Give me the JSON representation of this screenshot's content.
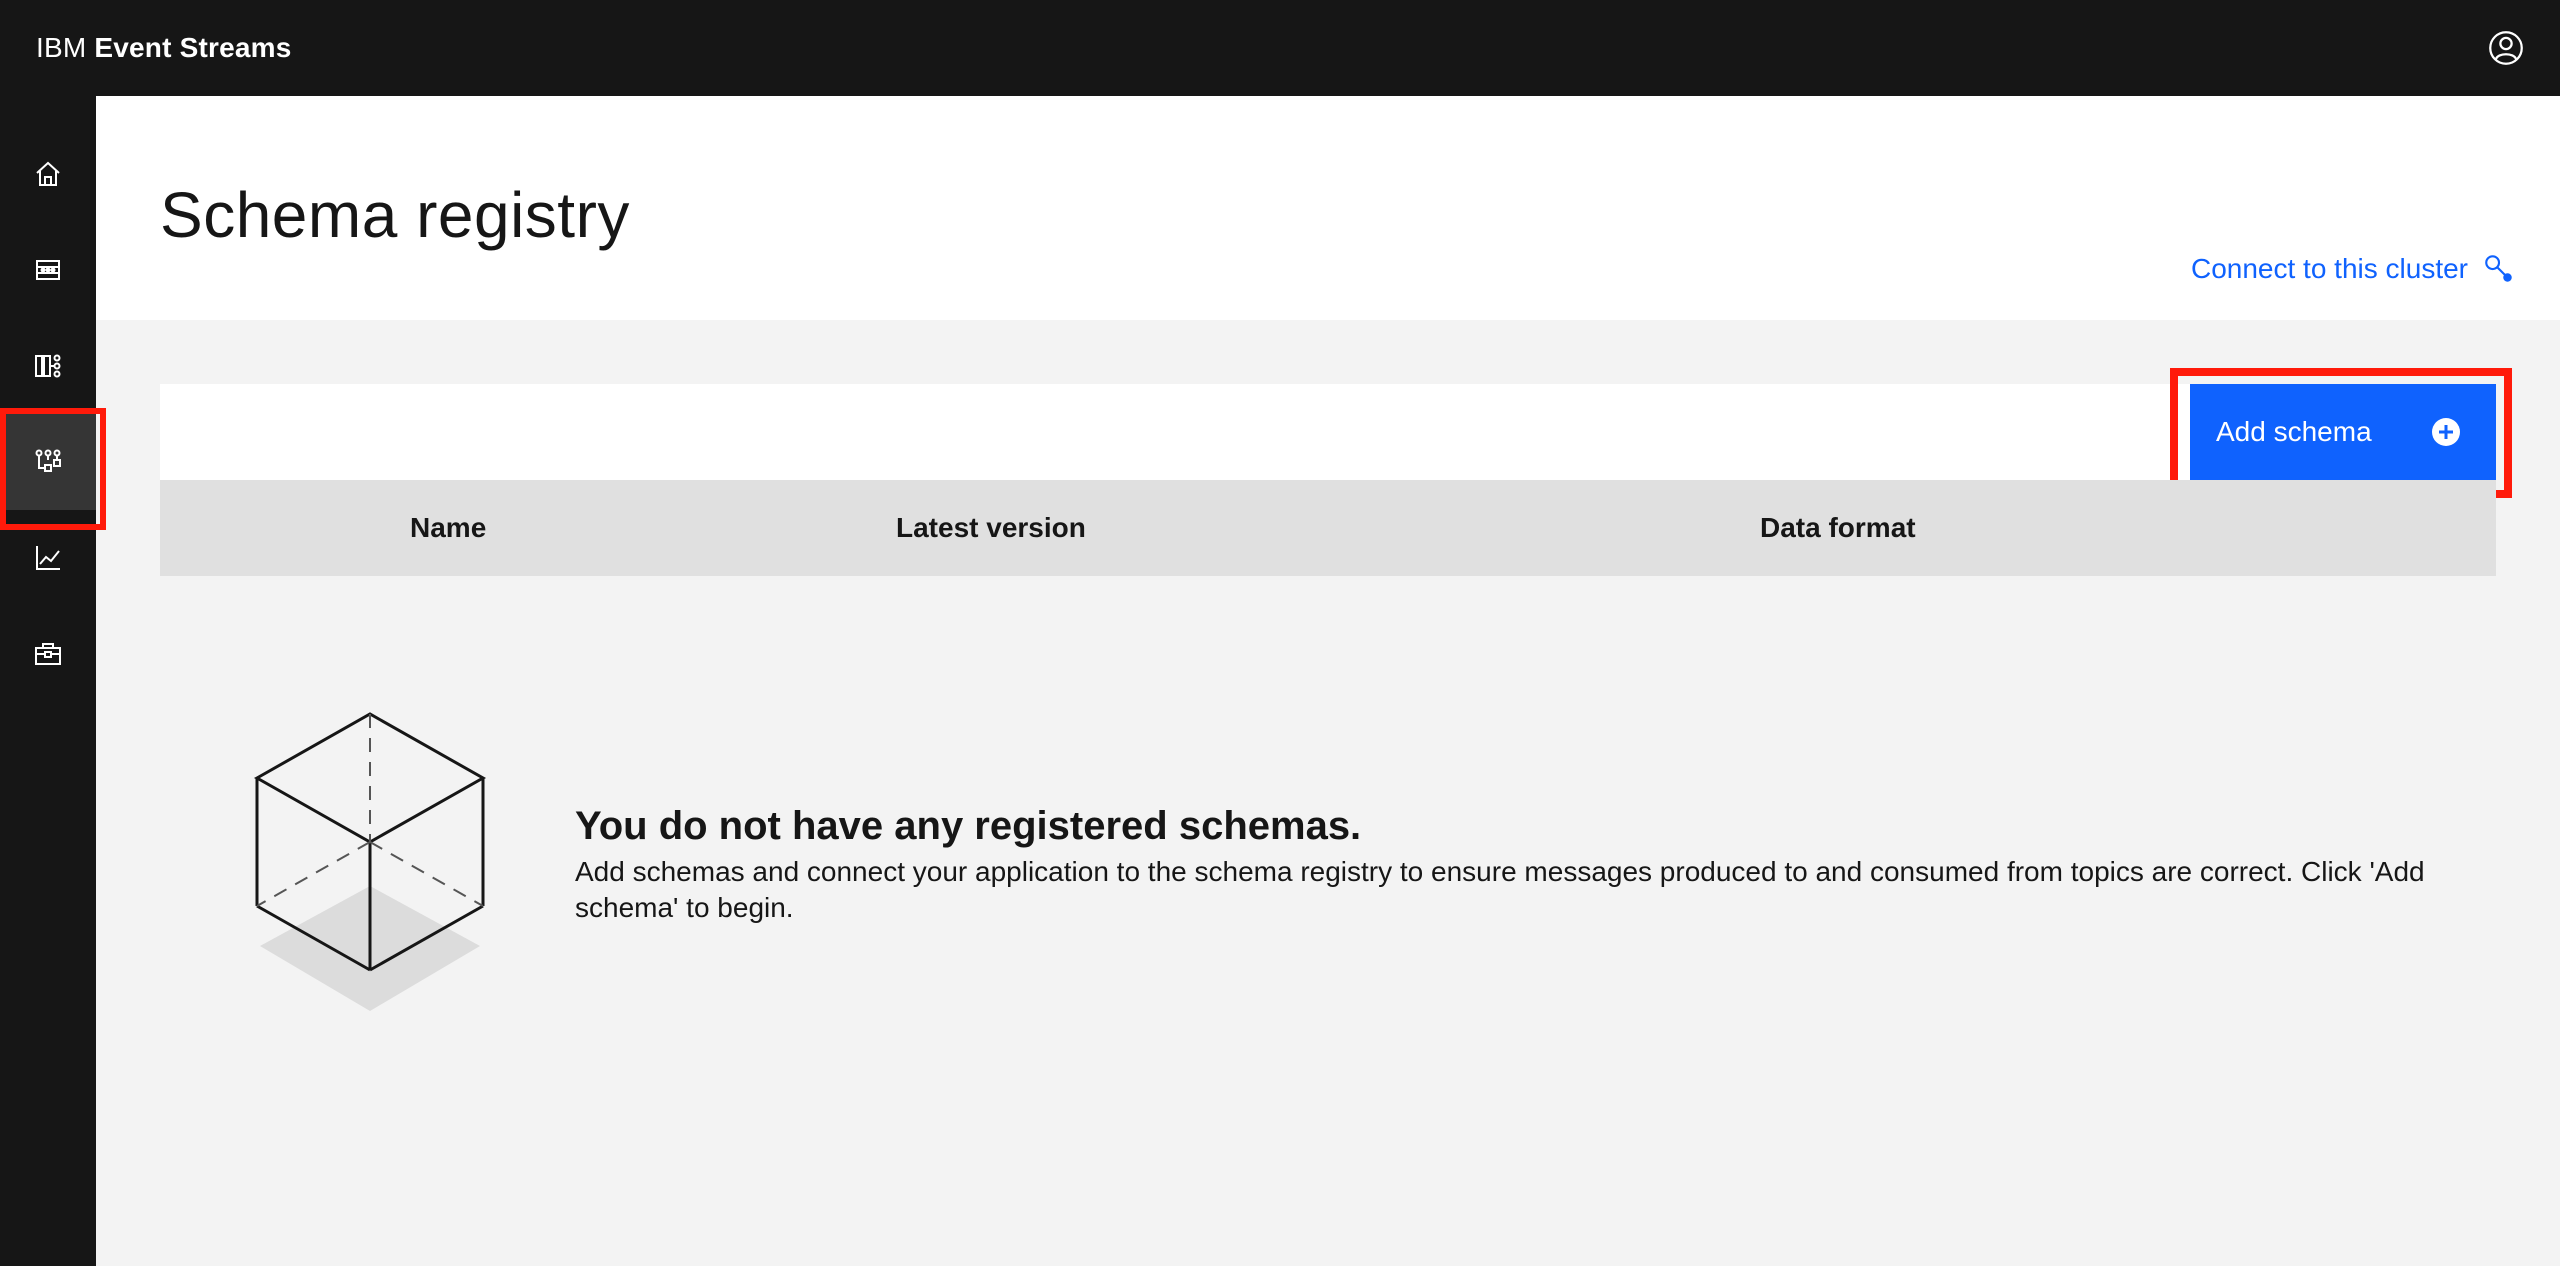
{
  "topbar": {
    "brand_prefix": "IBM",
    "brand_name": "Event Streams",
    "user_icon": "user-avatar-icon"
  },
  "sidenav": {
    "items": [
      {
        "icon": "home-icon",
        "active": false
      },
      {
        "icon": "topics-icon",
        "active": false
      },
      {
        "icon": "consumer-groups-icon",
        "active": false
      },
      {
        "icon": "schema-registry-icon",
        "active": true
      },
      {
        "icon": "monitoring-chart-icon",
        "active": false
      },
      {
        "icon": "toolbox-icon",
        "active": false
      }
    ]
  },
  "header": {
    "title": "Schema registry",
    "connect_label": "Connect to this cluster"
  },
  "toolbar": {
    "search_placeholder": "",
    "add_button_label": "Add schema"
  },
  "table": {
    "columns": [
      "Name",
      "Latest version",
      "Data format"
    ]
  },
  "empty_state": {
    "title": "You do not have any registered schemas.",
    "description": "Add schemas and connect your application to the schema registry to ensure messages produced to and consumed from topics are correct. Click 'Add schema' to begin."
  },
  "colors": {
    "topbar": "#161616",
    "primary": "#0f62fe",
    "highlight": "#ff1a0a",
    "table_header": "#e0e0e0",
    "background": "#f3f3f3"
  }
}
